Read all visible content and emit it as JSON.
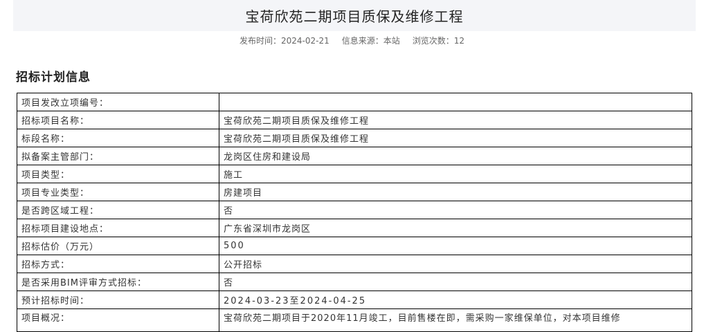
{
  "header": {
    "title": "宝荷欣苑二期项目质保及维修工程",
    "publish_label": "发布时间：2024-02-21",
    "source_label": "信息来源：本站",
    "views_label": "浏览次数：12"
  },
  "section": {
    "title": "招标计划信息"
  },
  "rows": [
    {
      "label": "项目发改立项编号：",
      "value": ""
    },
    {
      "label": "招标项目名称：",
      "value": "宝荷欣苑二期项目质保及维修工程"
    },
    {
      "label": "标段名称：",
      "value": "宝荷欣苑二期项目质保及维修工程"
    },
    {
      "label": "拟备案主管部门：",
      "value": "龙岗区住房和建设局"
    },
    {
      "label": "项目类型：",
      "value": "施工"
    },
    {
      "label": "项目专业类型：",
      "value": "房建项目"
    },
    {
      "label": "是否跨区域工程：",
      "value": "否"
    },
    {
      "label": "招标项目建设地点：",
      "value": "广东省深圳市龙岗区"
    },
    {
      "label": "招标估价（万元）",
      "value": "500"
    },
    {
      "label": "招标方式：",
      "value": "公开招标"
    },
    {
      "label": "是否采用BIM评审方式招标：",
      "value": "否"
    },
    {
      "label": "预计招标时间：",
      "value": "2024-03-23至2024-04-25"
    },
    {
      "label": "项目概况：",
      "value": "宝荷欣苑二期项目于2020年11月竣工，目前售楼在即，需采购一家维保单位，对本项目维修"
    }
  ]
}
